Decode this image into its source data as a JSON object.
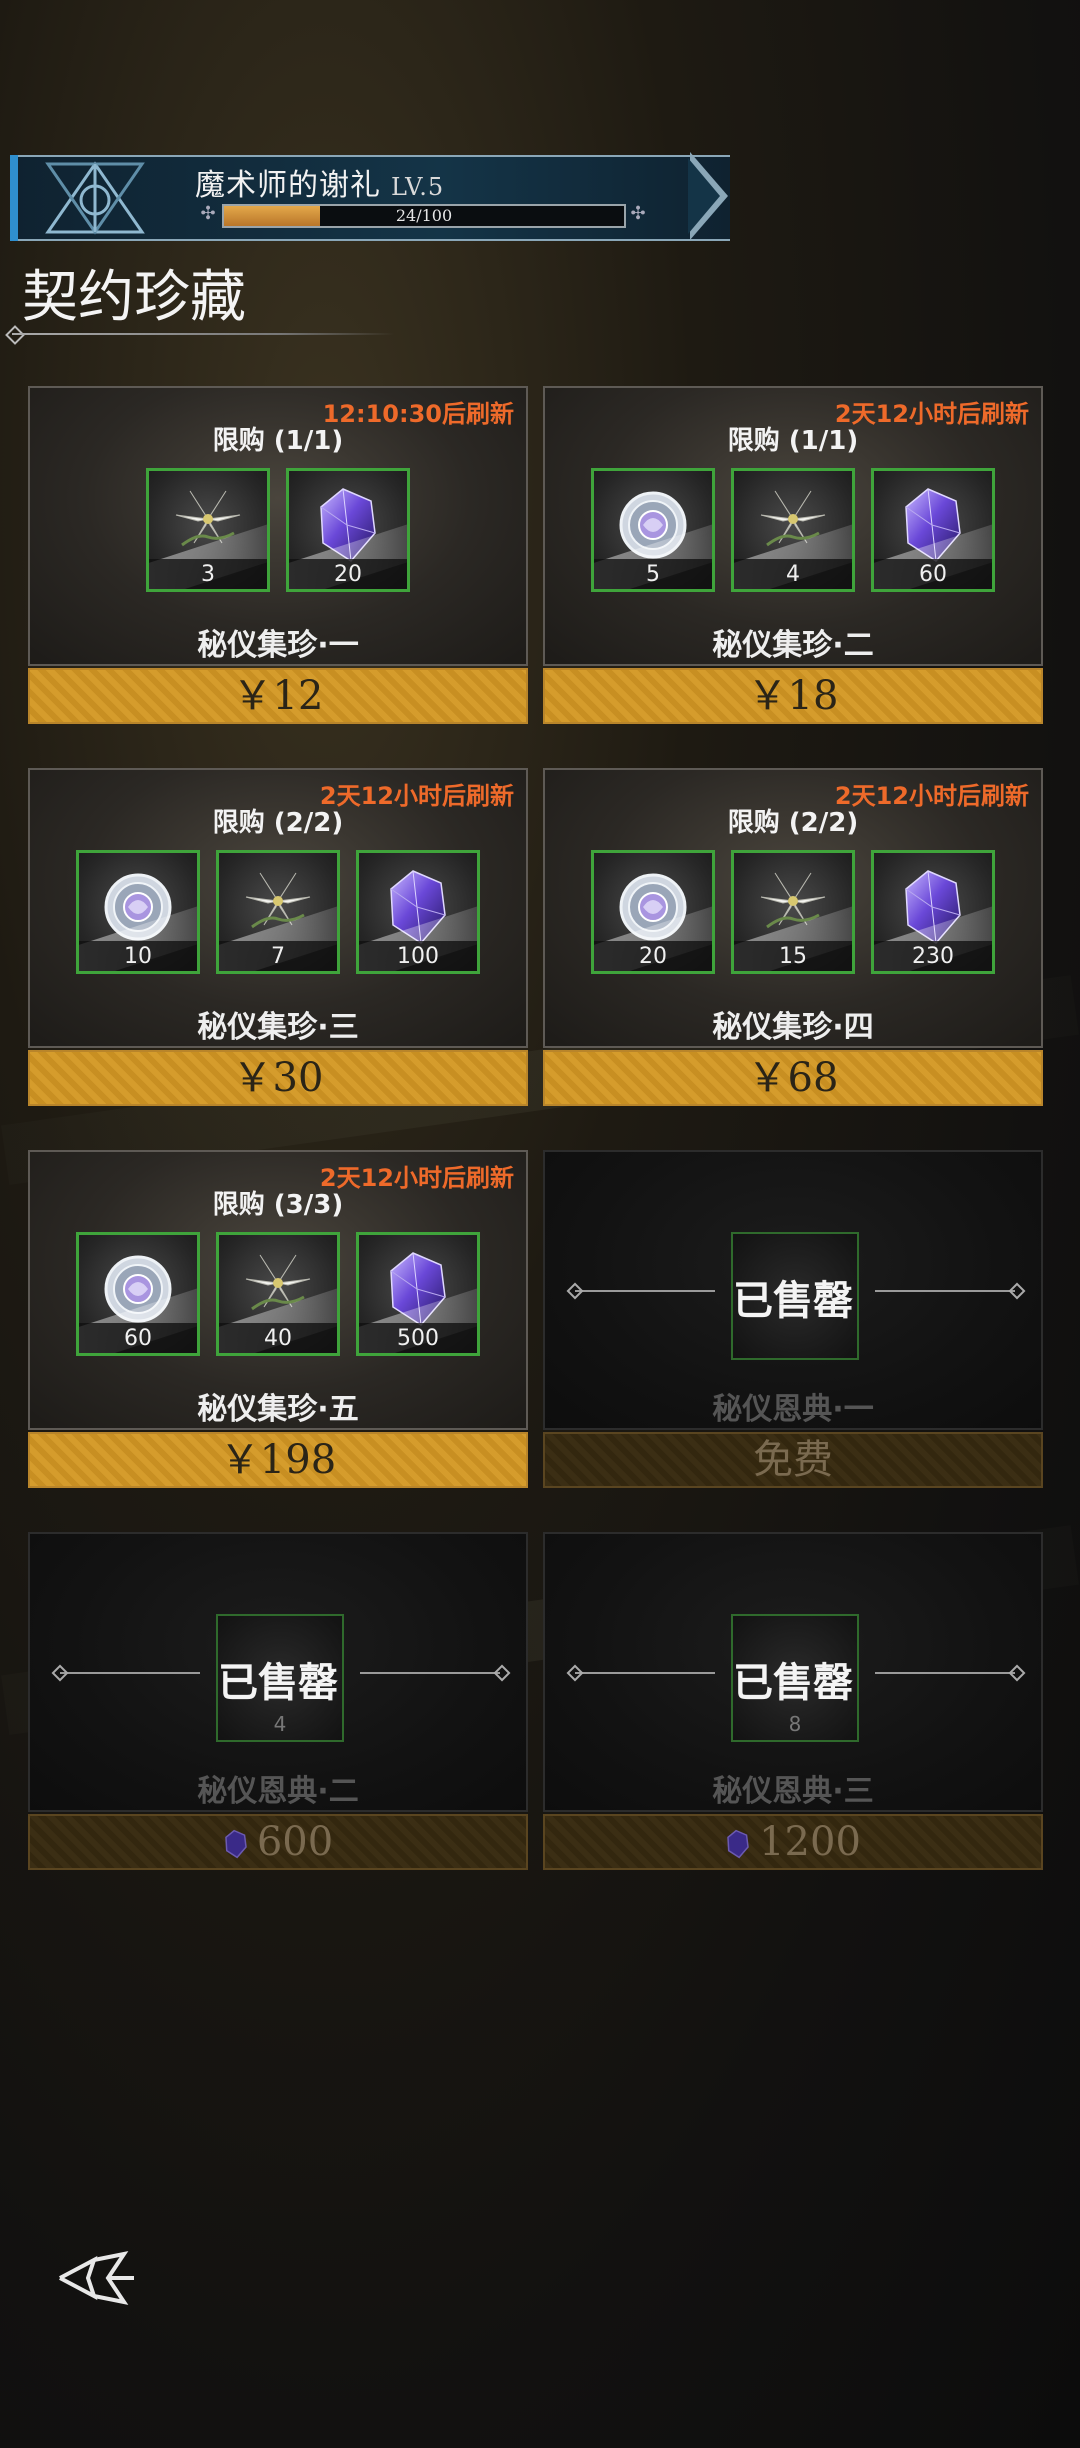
{
  "banner": {
    "title": "魔术师的谢礼",
    "level": "LV.5",
    "xp_text": "24/100",
    "xp_fraction": 0.24
  },
  "section_title": "契约珍藏",
  "cards": [
    {
      "refresh": "12:10:30后刷新",
      "limit": "限购 (1/1)",
      "name": "秘仪集珍·一",
      "price": "￥12",
      "items": [
        {
          "icon": "lily-icon",
          "qty": "3"
        },
        {
          "icon": "crystal-icon",
          "qty": "20"
        }
      ]
    },
    {
      "refresh": "2天12小时后刷新",
      "limit": "限购 (1/1)",
      "name": "秘仪集珍·二",
      "price": "￥18",
      "items": [
        {
          "icon": "coin-icon",
          "qty": "5"
        },
        {
          "icon": "lily-icon",
          "qty": "4"
        },
        {
          "icon": "crystal-icon",
          "qty": "60"
        }
      ]
    },
    {
      "refresh": "2天12小时后刷新",
      "limit": "限购 (2/2)",
      "name": "秘仪集珍·三",
      "price": "￥30",
      "items": [
        {
          "icon": "coin-icon",
          "qty": "10"
        },
        {
          "icon": "lily-icon",
          "qty": "7"
        },
        {
          "icon": "crystal-icon",
          "qty": "100"
        }
      ]
    },
    {
      "refresh": "2天12小时后刷新",
      "limit": "限购 (2/2)",
      "name": "秘仪集珍·四",
      "price": "￥68",
      "items": [
        {
          "icon": "coin-icon",
          "qty": "20"
        },
        {
          "icon": "lily-icon",
          "qty": "15"
        },
        {
          "icon": "crystal-icon",
          "qty": "230"
        }
      ]
    },
    {
      "refresh": "2天12小时后刷新",
      "limit": "限购 (3/3)",
      "name": "秘仪集珍·五",
      "price": "￥198",
      "items": [
        {
          "icon": "coin-icon",
          "qty": "60"
        },
        {
          "icon": "lily-icon",
          "qty": "40"
        },
        {
          "icon": "crystal-icon",
          "qty": "500"
        }
      ]
    }
  ],
  "soldout_cards": [
    {
      "sold_label": "已售罄",
      "qty": "",
      "name": "秘仪恩典·一",
      "price": "免费"
    },
    {
      "sold_label": "已售罄",
      "qty": "4",
      "name": "秘仪恩典·二",
      "price": "600",
      "price_icon": "crystal-icon"
    },
    {
      "sold_label": "已售罄",
      "qty": "8",
      "name": "秘仪恩典·三",
      "price": "1200",
      "price_icon": "crystal-icon"
    }
  ],
  "nav": {
    "back_icon": "back-arrow-icon"
  },
  "colors": {
    "refresh_text": "#ee6a2a",
    "price_gold": "#d59c2c",
    "item_border": "#3fa43b",
    "banner_accent": "#2f8fcf"
  }
}
